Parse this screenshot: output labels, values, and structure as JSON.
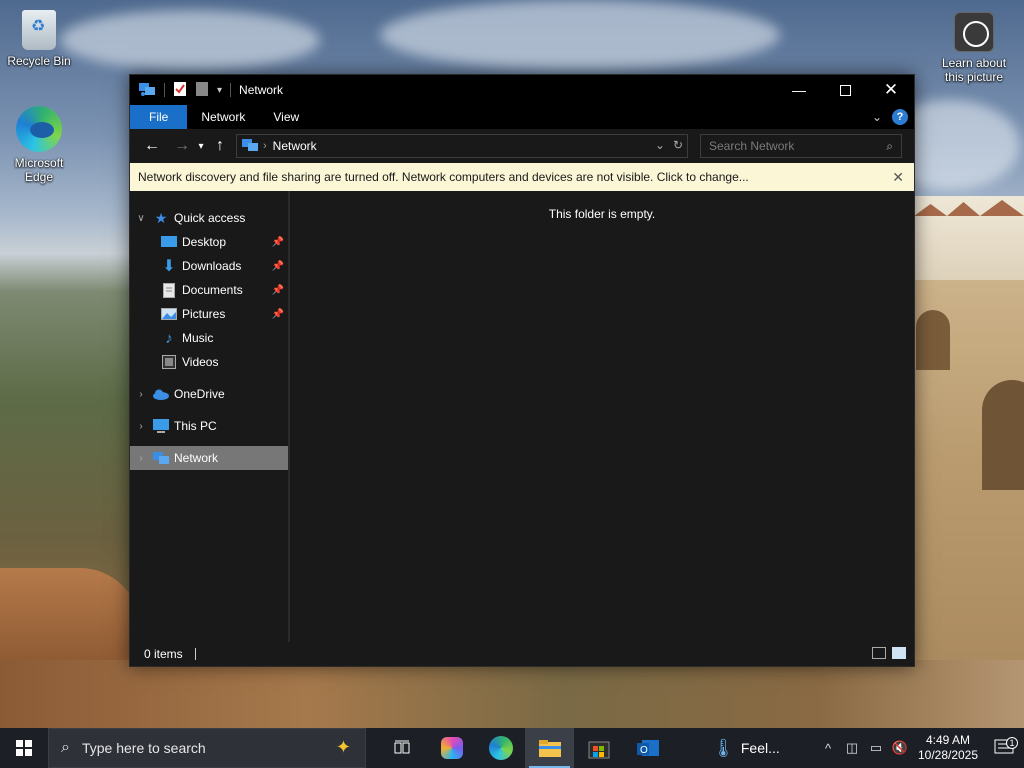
{
  "desktop": {
    "icons": [
      {
        "label": "Recycle Bin"
      },
      {
        "label": "Microsoft Edge"
      },
      {
        "label": "Learn about this picture"
      }
    ]
  },
  "window": {
    "title": "Network",
    "ribbon_tabs": [
      "File",
      "Network",
      "View"
    ],
    "address": "Network",
    "search_placeholder": "Search Network",
    "infobar": "Network discovery and file sharing are turned off. Network computers and devices are not visible. Click to change...",
    "empty_message": "This folder is empty.",
    "status": "0 items",
    "sidebar": {
      "quick_access": "Quick access",
      "quick_items": [
        {
          "label": "Desktop",
          "icon": "desktop-icon",
          "pinned": true
        },
        {
          "label": "Downloads",
          "icon": "download-icon",
          "pinned": true
        },
        {
          "label": "Documents",
          "icon": "document-icon",
          "pinned": true
        },
        {
          "label": "Pictures",
          "icon": "pictures-icon",
          "pinned": true
        },
        {
          "label": "Music",
          "icon": "music-icon",
          "pinned": false
        },
        {
          "label": "Videos",
          "icon": "videos-icon",
          "pinned": false
        }
      ],
      "onedrive": "OneDrive",
      "this_pc": "This PC",
      "network": "Network"
    }
  },
  "taskbar": {
    "search_placeholder": "Type here to search",
    "weather": "Feel...",
    "time": "4:49 AM",
    "date": "10/28/2025",
    "notification_count": "1"
  },
  "colors": {
    "accent": "#1a6fc9",
    "infobar_bg": "#fbf6d6",
    "window_bg": "#191919",
    "taskbar_bg": "#1c1f26"
  }
}
